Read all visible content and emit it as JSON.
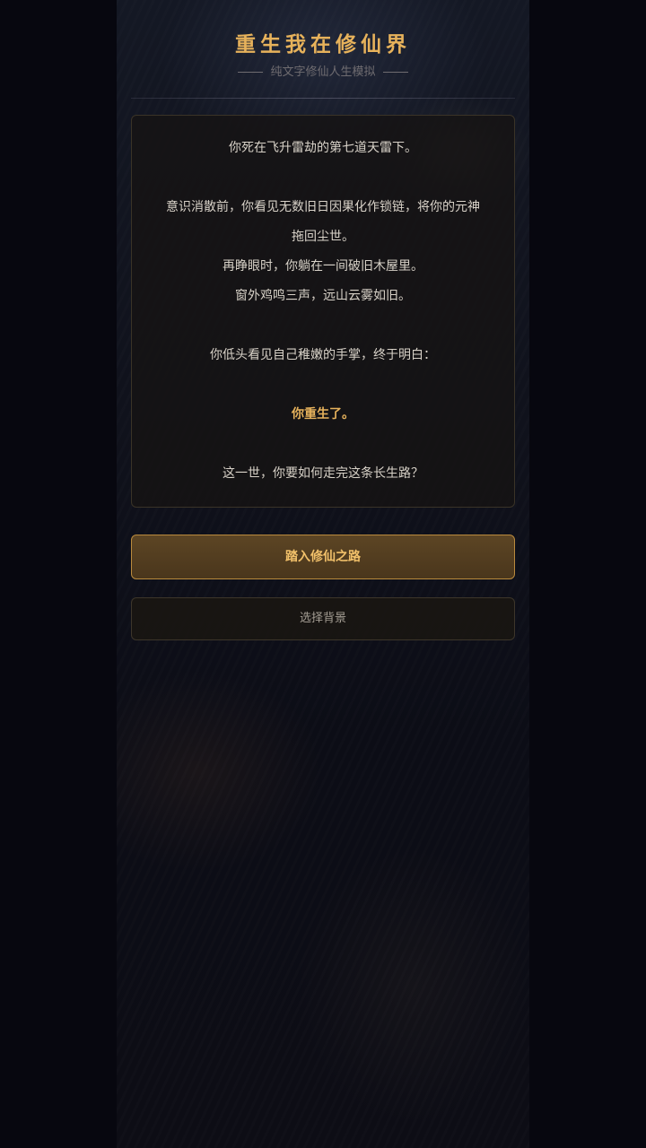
{
  "header": {
    "title": "重生我在修仙界",
    "subtitle": "纯文字修仙人生模拟"
  },
  "story": {
    "lines": [
      "你死在飞升雷劫的第七道天雷下。",
      "意识消散前，你看见无数旧日因果化作锁链，将你的元神",
      "拖回尘世。",
      "再睁眼时，你躺在一间破旧木屋里。",
      "窗外鸡鸣三声，远山云雾如旧。",
      "你低头看见自己稚嫩的手掌，终于明白：",
      "你重生了。",
      "这一世，你要如何走完这条长生路？"
    ]
  },
  "actions": {
    "start_label": "踏入修仙之路",
    "background_label": "选择背景"
  },
  "colors": {
    "accent": "#e7b25b",
    "background": "#07070f"
  }
}
